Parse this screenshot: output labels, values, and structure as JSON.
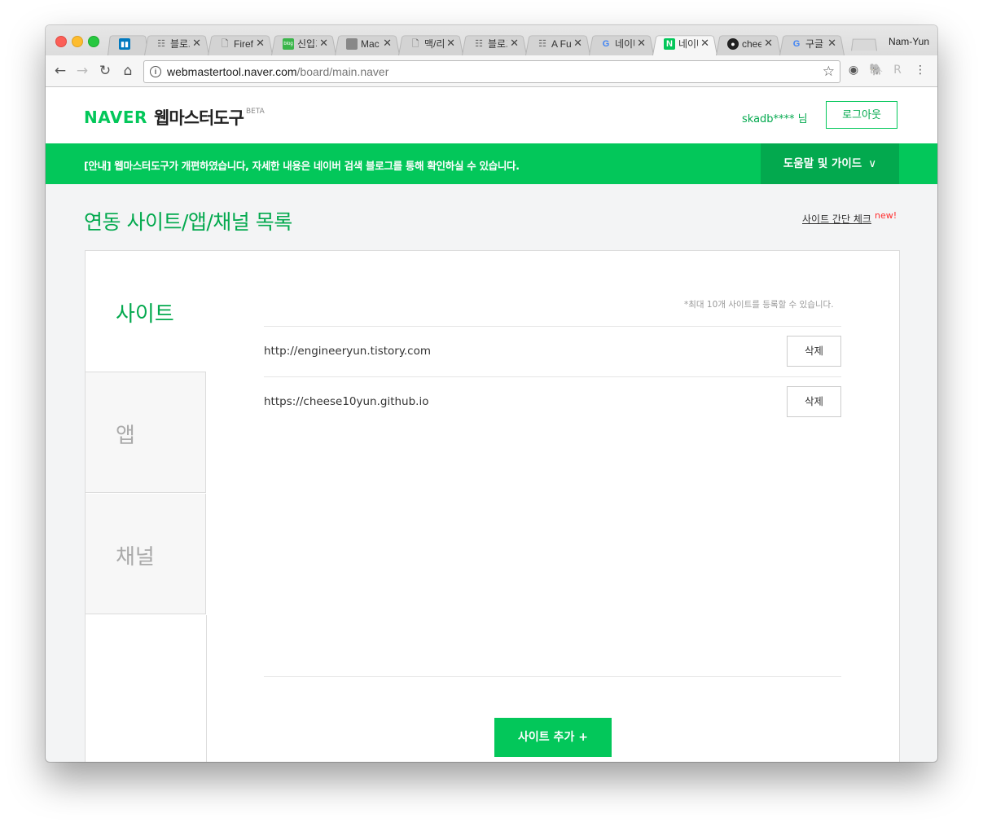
{
  "browser": {
    "tabs": [
      {
        "icon": "trello-icon",
        "title": ""
      },
      {
        "icon": "list-icon",
        "title": "블로그"
      },
      {
        "icon": "page-icon",
        "title": "Firefox"
      },
      {
        "icon": "blog-icon",
        "title": "신입기"
      },
      {
        "icon": "apple-icon",
        "title": "Mac"
      },
      {
        "icon": "page-icon",
        "title": "맥/리"
      },
      {
        "icon": "list-icon",
        "title": "블로그"
      },
      {
        "icon": "list-icon",
        "title": "A Fu"
      },
      {
        "icon": "google-icon",
        "title": "네이버"
      },
      {
        "icon": "naver-icon",
        "title": "네이버"
      },
      {
        "icon": "github-icon",
        "title": "chee"
      },
      {
        "icon": "google-icon",
        "title": "구글"
      }
    ],
    "profile": "Nam-Yun",
    "url_host": "webmastertool.naver.com",
    "url_path": "/board/main.naver"
  },
  "header": {
    "logo": "NAVER",
    "title": "웹마스터도구",
    "beta": "BETA",
    "user": "skadb**** 님",
    "logout": "로그아웃"
  },
  "notice": {
    "text": "[안내] 웹마스터도구가 개편하였습니다, 자세한 내용은 네이버 검색 블로그를 통해 확인하실 수 있습니다.",
    "help": "도움말 및 가이드"
  },
  "main": {
    "title": "연동 사이트/앱/채널 목록",
    "site_check": "사이트 간단 체크",
    "site_check_new": "new!",
    "side_tabs": [
      "사이트",
      "앱",
      "채널"
    ],
    "limit_note": "*최대 10개 사이트를 등록할 수 있습니다.",
    "sites": [
      {
        "url": "http://engineeryun.tistory.com",
        "delete": "삭제"
      },
      {
        "url": "https://cheese10yun.github.io",
        "delete": "삭제"
      }
    ],
    "add_button": "사이트 추가 +"
  },
  "colors": {
    "accent": "#03c75a",
    "accent_dark": "#03a94e"
  }
}
